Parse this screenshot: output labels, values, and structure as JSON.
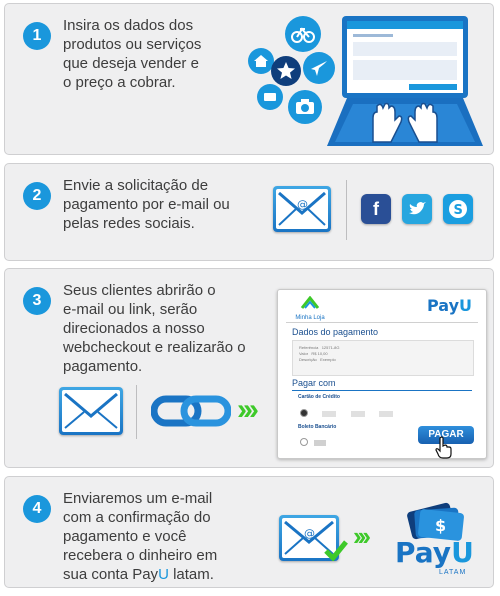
{
  "steps": [
    {
      "number": "1",
      "lines": [
        "Insira os dados dos",
        "produtos ou serviços",
        "que deseja vender e",
        "o preço a cobrar."
      ]
    },
    {
      "number": "2",
      "lines": [
        "Envie a solicitação de",
        "pagamento por e-mail ou",
        "pelas redes sociais."
      ]
    },
    {
      "number": "3",
      "lines": [
        "Seus clientes abrirão o",
        "e-mail ou link, serão",
        "direcionados a nosso",
        "webcheckout e realizarão o",
        "pagamento."
      ]
    },
    {
      "number": "4",
      "lines": [
        "Enviaremos um e-mail",
        "com a confirmação do",
        "pagamento e você",
        "recebera o dinheiro em"
      ],
      "last_prefix": "sua conta Pay",
      "last_highlight": "U",
      "last_suffix": " latam."
    }
  ],
  "checkout": {
    "store_name": "Minha Loja",
    "brand_pay": "Pay",
    "brand_u": "U",
    "section_title": "Dados do pagamento",
    "rows": [
      [
        "Referência",
        "12571-8G"
      ],
      [
        "Valor",
        "R$ 10,00"
      ],
      [
        "Descrição",
        "Exemplo"
      ]
    ],
    "pay_with": "Pagar com",
    "credit_card_label": "Cartão de Crédito",
    "boleto_label": "Boleto Bancário",
    "pay_button": "PAGAR"
  },
  "payu_logo": {
    "pay": "Pay",
    "u": "U",
    "sub": "LATAM"
  },
  "colors": {
    "accent": "#1a97dc",
    "dark_blue": "#1a74c4",
    "green": "#3ec92a",
    "facebook": "#2a4f96",
    "twitter": "#27a6df",
    "skype": "#1b9ee0"
  },
  "icons": [
    "bicycle-icon",
    "home-icon",
    "star-icon",
    "airplane-icon",
    "camera-icon",
    "laptop-icon",
    "hands-icon",
    "email-icon",
    "facebook-icon",
    "twitter-icon",
    "skype-icon",
    "link-icon",
    "chevrons-icon",
    "cursor-hand-icon",
    "checkmark-icon",
    "money-cards-icon"
  ]
}
